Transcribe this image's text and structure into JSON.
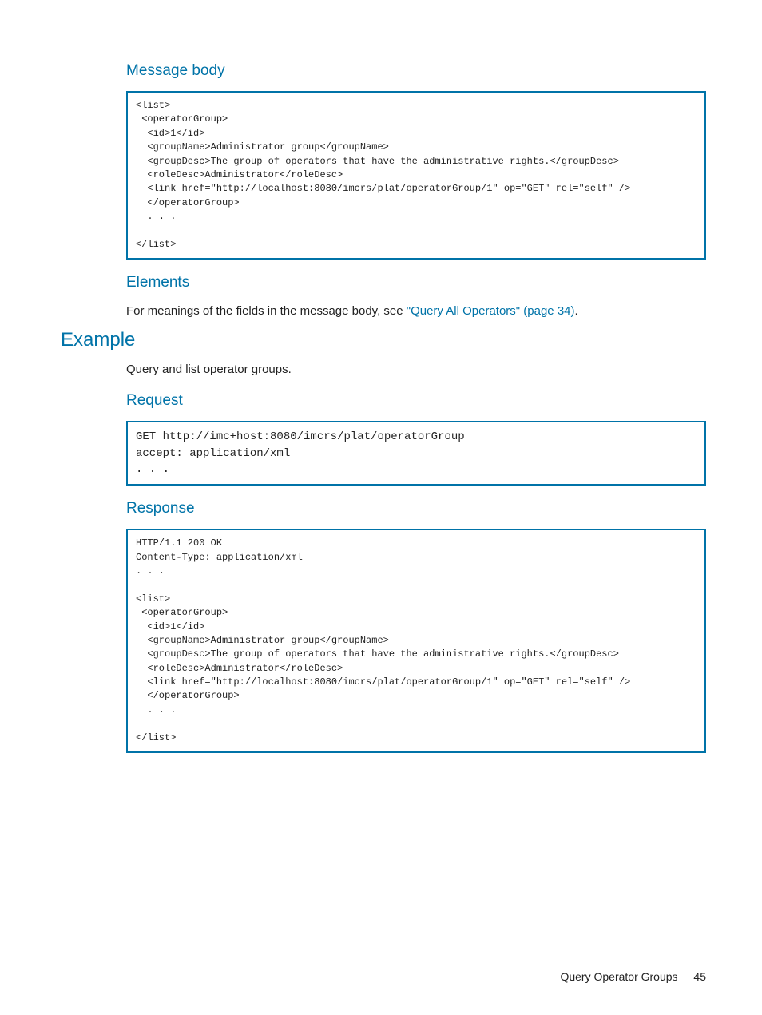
{
  "sections": {
    "messageBody": {
      "title": "Message body",
      "code": "<list>\n <operatorGroup>\n  <id>1</id>\n  <groupName>Administrator group</groupName>\n  <groupDesc>The group of operators that have the administrative rights.</groupDesc>\n  <roleDesc>Administrator</roleDesc>\n  <link href=\"http://localhost:8080/imcrs/plat/operatorGroup/1\" op=\"GET\" rel=\"self\" />\n  </operatorGroup>\n  . . .\n\n</list>"
    },
    "elements": {
      "title": "Elements",
      "textBefore": "For meanings of the fields in the message body, see ",
      "link": "\"Query All Operators\" (page 34)",
      "textAfter": "."
    },
    "example": {
      "title": "Example",
      "intro": "Query and list operator groups."
    },
    "request": {
      "title": "Request",
      "code": "GET http://imc+host:8080/imcrs/plat/operatorGroup\naccept: application/xml\n. . ."
    },
    "response": {
      "title": "Response",
      "code": "HTTP/1.1 200 OK\nContent-Type: application/xml\n. . .\n\n<list>\n <operatorGroup>\n  <id>1</id>\n  <groupName>Administrator group</groupName>\n  <groupDesc>The group of operators that have the administrative rights.</groupDesc>\n  <roleDesc>Administrator</roleDesc>\n  <link href=\"http://localhost:8080/imcrs/plat/operatorGroup/1\" op=\"GET\" rel=\"self\" />\n  </operatorGroup>\n  . . .\n\n</list>"
    }
  },
  "footer": {
    "label": "Query Operator Groups",
    "page": "45"
  }
}
